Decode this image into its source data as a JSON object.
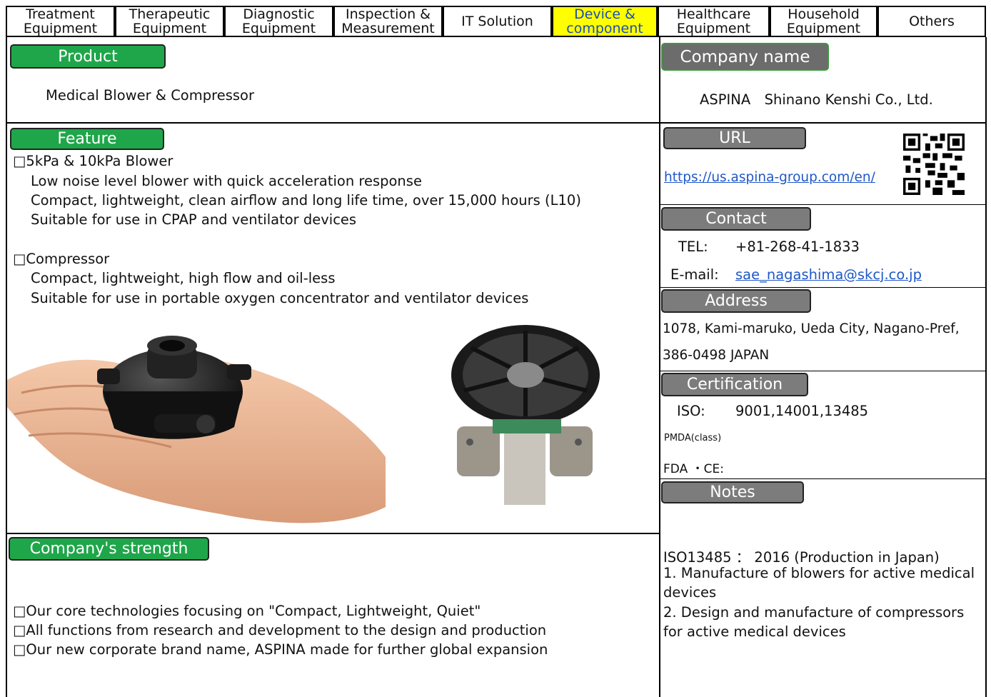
{
  "tabs": [
    {
      "label": "Treatment\nEquipment",
      "active": false
    },
    {
      "label": "Therapeutic\nEquipment",
      "active": false
    },
    {
      "label": "Diagnostic\nEquipment",
      "active": false
    },
    {
      "label": "Inspection &\nMeasurement",
      "active": false
    },
    {
      "label": "IT Solution",
      "active": false
    },
    {
      "label": "Device &\ncomponent",
      "active": true
    },
    {
      "label": "Healthcare\nEquipment",
      "active": false
    },
    {
      "label": "Household\nEquipment",
      "active": false
    },
    {
      "label": "Others",
      "active": false
    }
  ],
  "product": {
    "heading": "Product",
    "value": "Medical Blower & Compressor"
  },
  "company": {
    "heading": "Company name",
    "value": "ASPINA　Shinano Kenshi Co., Ltd."
  },
  "feature": {
    "heading": "Feature",
    "lines": [
      "□5kPa & 10kPa Blower",
      "Low noise level blower with quick acceleration response",
      "Compact, lightweight, clean airflow and long life time, over 15,000 hours (L10)",
      "Suitable for use in CPAP and ventilator devices",
      "□Compressor",
      "Compact, lightweight, high flow and oil-less",
      "Suitable for use in portable oxygen concentrator and ventilator devices"
    ]
  },
  "url": {
    "heading": "URL",
    "value": "https://us.aspina-group.com/en/"
  },
  "contact": {
    "heading": "Contact",
    "tel_label": "TEL:",
    "tel_value": "+81-268-41-1833",
    "email_label": "E-mail:",
    "email_value": "sae_nagashima@skcj.co.jp"
  },
  "address": {
    "heading": "Address",
    "line1": "1078, Kami-maruko, Ueda City, Nagano-Pref,",
    "line2": "386-0498 JAPAN"
  },
  "certification": {
    "heading": "Certification",
    "iso_label": "ISO:",
    "iso_value": "9001,14001,13485",
    "pmda": "PMDA(class)",
    "fda": "FDA ・CE:"
  },
  "notes": {
    "heading": "Notes",
    "lines": [
      "ISO13485 ： 2016 (Production in Japan)",
      "1. Manufacture of blowers for active medical",
      "devices",
      "2. Design and manufacture of compressors",
      "for active medical devices"
    ]
  },
  "strength": {
    "heading": "Company's strength",
    "lines": [
      "□Our core technologies focusing on \"Compact, Lightweight, Quiet\"",
      "□All functions from research and development to the design and production",
      "□Our new corporate brand name, ASPINA made for further global expansion"
    ]
  }
}
